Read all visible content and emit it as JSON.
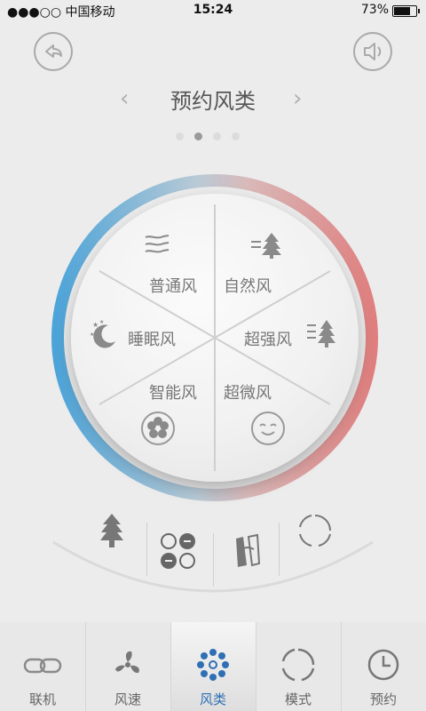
{
  "status_bar": {
    "carrier": "●●●○○ 中国移动",
    "time": "15:24",
    "battery": "73%"
  },
  "header": {
    "title": "预约风类"
  },
  "pager": {
    "count": 4,
    "active_index": 1
  },
  "wheel": {
    "segments": [
      {
        "label": "普通风",
        "icon": "wind-lines-icon"
      },
      {
        "label": "自然风",
        "icon": "tree-wind-icon"
      },
      {
        "label": "超强风",
        "icon": "strong-wind-tree-icon"
      },
      {
        "label": "超微风",
        "icon": "smile-face-icon"
      },
      {
        "label": "智能风",
        "icon": "flower-icon"
      },
      {
        "label": "睡眠风",
        "icon": "moon-stars-icon"
      }
    ]
  },
  "colors": {
    "ring_left": "#4aa3d9",
    "ring_right": "#e07d7d",
    "accent": "#2f6fb4"
  },
  "tabs": [
    {
      "label": "联机",
      "icon": "link-icon"
    },
    {
      "label": "风速",
      "icon": "fan-icon"
    },
    {
      "label": "风类",
      "icon": "wind-type-icon",
      "active": true
    },
    {
      "label": "模式",
      "icon": "mode-icon"
    },
    {
      "label": "预约",
      "icon": "clock-icon"
    }
  ]
}
